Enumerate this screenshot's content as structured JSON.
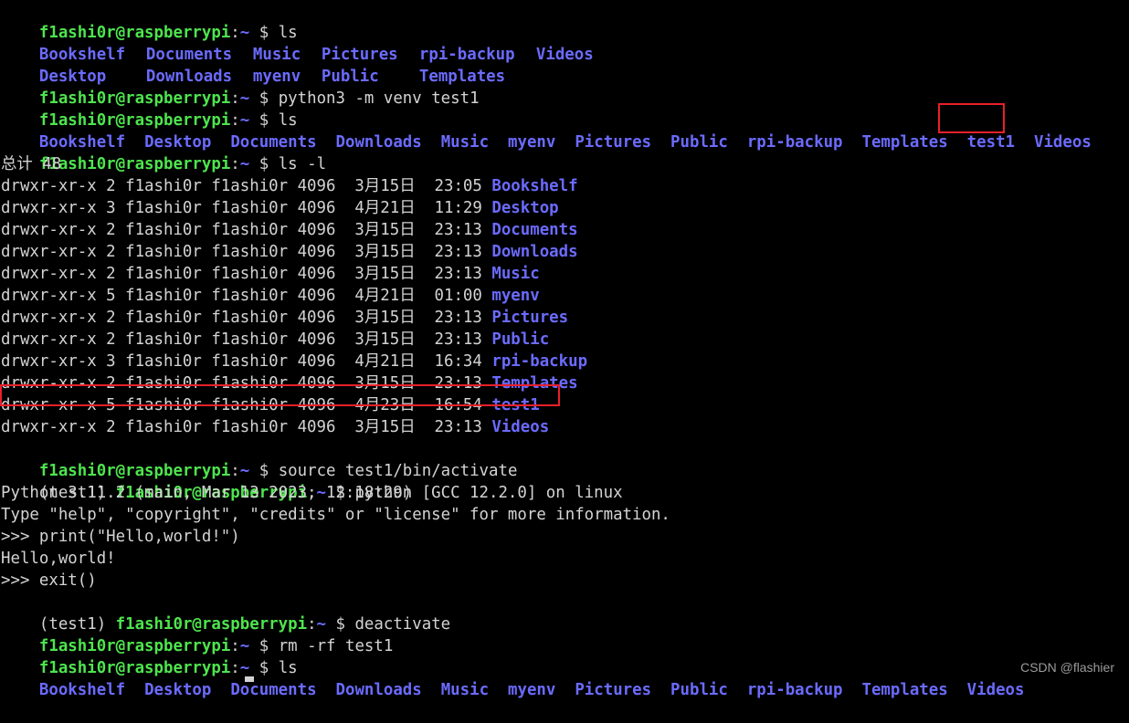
{
  "prompt": {
    "user": "f1ashi0r@raspberrypi",
    "sep": ":",
    "path": "~",
    "symbol": " $ "
  },
  "venv_prefix": "(test1) ",
  "commands": {
    "ls": "ls",
    "venv": "python3 -m venv test1",
    "ls_l": "ls -l",
    "activate": "source test1/bin/activate",
    "python": "python",
    "deactivate": "deactivate",
    "rm": "rm -rf test1"
  },
  "ls1": {
    "row1": [
      "Bookshelf",
      "Documents",
      "Music",
      "Pictures",
      "rpi-backup",
      "Videos"
    ],
    "row2": [
      "Desktop",
      "Downloads",
      "myenv",
      "Public",
      "Templates"
    ]
  },
  "ls2": [
    "Bookshelf",
    "Desktop",
    "Documents",
    "Downloads",
    "Music",
    "myenv",
    "Pictures",
    "Public",
    "rpi-backup",
    "Templates",
    "test1",
    "Videos"
  ],
  "ls_total": "总计 48",
  "ls_l_rows": [
    {
      "meta": "drwxr-xr-x 2 f1ashi0r f1ashi0r 4096  3月15日  23:05 ",
      "name": "Bookshelf"
    },
    {
      "meta": "drwxr-xr-x 3 f1ashi0r f1ashi0r 4096  4月21日  11:29 ",
      "name": "Desktop"
    },
    {
      "meta": "drwxr-xr-x 2 f1ashi0r f1ashi0r 4096  3月15日  23:13 ",
      "name": "Documents"
    },
    {
      "meta": "drwxr-xr-x 2 f1ashi0r f1ashi0r 4096  3月15日  23:13 ",
      "name": "Downloads"
    },
    {
      "meta": "drwxr-xr-x 2 f1ashi0r f1ashi0r 4096  3月15日  23:13 ",
      "name": "Music"
    },
    {
      "meta": "drwxr-xr-x 5 f1ashi0r f1ashi0r 4096  4月21日  01:00 ",
      "name": "myenv"
    },
    {
      "meta": "drwxr-xr-x 2 f1ashi0r f1ashi0r 4096  3月15日  23:13 ",
      "name": "Pictures"
    },
    {
      "meta": "drwxr-xr-x 2 f1ashi0r f1ashi0r 4096  3月15日  23:13 ",
      "name": "Public"
    },
    {
      "meta": "drwxr-xr-x 3 f1ashi0r f1ashi0r 4096  4月21日  16:34 ",
      "name": "rpi-backup"
    },
    {
      "meta": "drwxr-xr-x 2 f1ashi0r f1ashi0r 4096  3月15日  23:13 ",
      "name": "Templates"
    },
    {
      "meta": "drwxr-xr-x 5 f1ashi0r f1ashi0r 4096  4月23日  16:54 ",
      "name": "test1"
    },
    {
      "meta": "drwxr-xr-x 2 f1ashi0r f1ashi0r 4096  3月15日  23:13 ",
      "name": "Videos"
    }
  ],
  "python_output": {
    "banner1": "Python 3.11.2 (main, Mar 13 2023, 12:18:29) [GCC 12.2.0] on linux",
    "banner2": "Type \"help\", \"copyright\", \"credits\" or \"license\" for more information.",
    "in1": ">>> print(\"Hello,world!\")",
    "out1": "Hello,world!",
    "in2": ">>> exit()"
  },
  "ls3": [
    "Bookshelf",
    "Desktop",
    "Documents",
    "Downloads",
    "Music",
    "myenv",
    "Pictures",
    "Public",
    "rpi-backup",
    "Templates",
    "Videos"
  ],
  "watermark": "CSDN @flashier",
  "colors": {
    "user": "#4ee44e",
    "directory": "#6b6bff",
    "text": "#d3d3d3",
    "highlight": "#e8202a",
    "background": "#000000"
  }
}
